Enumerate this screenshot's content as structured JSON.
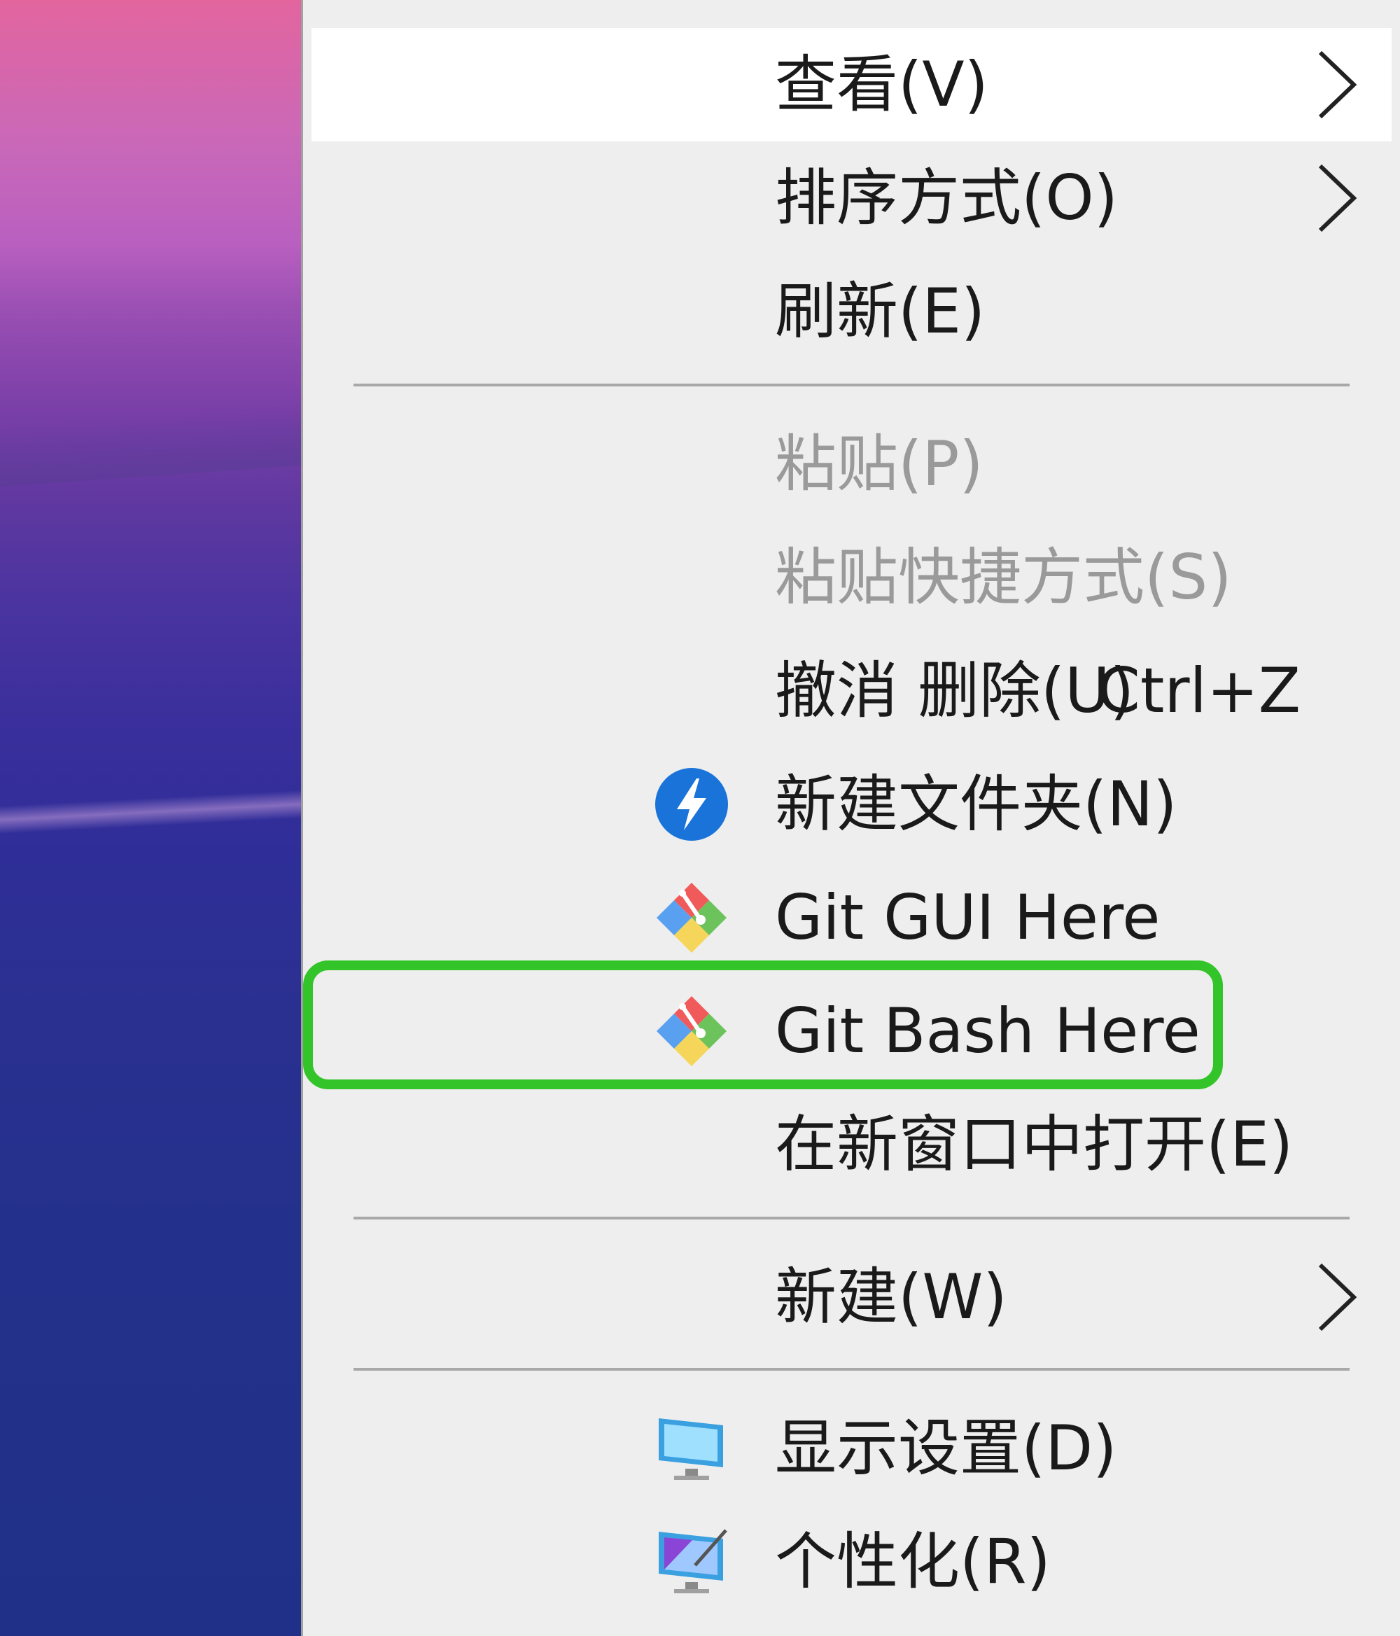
{
  "context_menu": {
    "items": [
      {
        "label": "查看(V)",
        "has_submenu": true,
        "disabled": false,
        "hover": true
      },
      {
        "label": "排序方式(O)",
        "has_submenu": true,
        "disabled": false
      },
      {
        "label": "刷新(E)",
        "has_submenu": false,
        "disabled": false
      },
      {
        "label": "粘贴(P)",
        "has_submenu": false,
        "disabled": true
      },
      {
        "label": "粘贴快捷方式(S)",
        "has_submenu": false,
        "disabled": true
      },
      {
        "label": "撤消 删除(U)",
        "shortcut": "Ctrl+Z",
        "has_submenu": false,
        "disabled": false
      },
      {
        "label": "新建文件夹(N)",
        "icon": "lightning-circle-icon",
        "has_submenu": false,
        "disabled": false
      },
      {
        "label": "Git GUI Here",
        "icon": "git-gui-icon",
        "has_submenu": false,
        "disabled": false
      },
      {
        "label": "Git Bash Here",
        "icon": "git-bash-icon",
        "has_submenu": false,
        "disabled": false,
        "highlighted": true
      },
      {
        "label": "在新窗口中打开(E)",
        "has_submenu": false,
        "disabled": false
      },
      {
        "label": "新建(W)",
        "has_submenu": true,
        "disabled": false
      },
      {
        "label": "显示设置(D)",
        "icon": "display-settings-icon",
        "has_submenu": false,
        "disabled": false
      },
      {
        "label": "个性化(R)",
        "icon": "personalize-icon",
        "has_submenu": false,
        "disabled": false
      }
    ]
  },
  "colors": {
    "menu_background": "#eeeeee",
    "hover_background": "#ffffff",
    "disabled_text": "#9a9a9a",
    "highlight_border": "#33c42a"
  }
}
